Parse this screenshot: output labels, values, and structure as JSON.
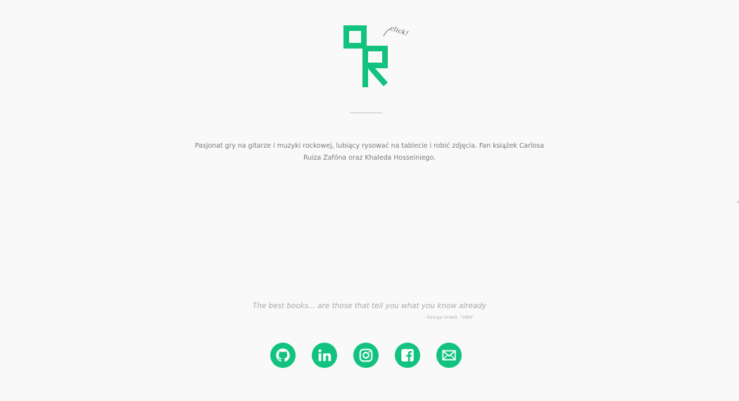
{
  "logo": {
    "click_label": "click!"
  },
  "bio": {
    "line1": "Pasjonat gry na gitarze i muzyki rockowej, lubiący rysować na tablecie i robić zdjęcia. Fan książek Carlosa",
    "line2": "Ruiza Zafóna oraz Khaleda Hosseiniego."
  },
  "quote": {
    "text": "The best books... are those that tell you what you know already",
    "author": "- George Orwell, \"1984\""
  },
  "social": {
    "items": [
      {
        "icon": "github-icon"
      },
      {
        "icon": "linkedin-icon"
      },
      {
        "icon": "instagram-icon"
      },
      {
        "icon": "facebook-icon"
      },
      {
        "icon": "mail-icon"
      }
    ]
  },
  "colors": {
    "accent": "#11c37f",
    "background": "#f9f9f9",
    "text": "#7a7a7a",
    "quote": "#aaaaaa"
  }
}
